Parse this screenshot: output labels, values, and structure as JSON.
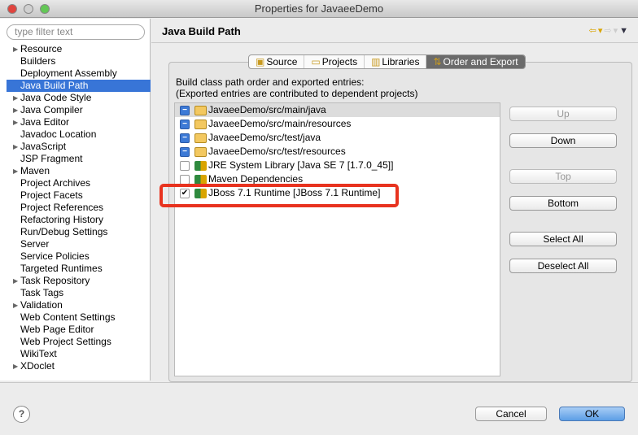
{
  "window": {
    "title": "Properties for JavaeeDemo"
  },
  "sidebar": {
    "filter_placeholder": "type filter text",
    "items": [
      {
        "label": "Resource",
        "expandable": true
      },
      {
        "label": "Builders"
      },
      {
        "label": "Deployment Assembly"
      },
      {
        "label": "Java Build Path",
        "selected": true
      },
      {
        "label": "Java Code Style",
        "expandable": true
      },
      {
        "label": "Java Compiler",
        "expandable": true
      },
      {
        "label": "Java Editor",
        "expandable": true
      },
      {
        "label": "Javadoc Location"
      },
      {
        "label": "JavaScript",
        "expandable": true
      },
      {
        "label": "JSP Fragment"
      },
      {
        "label": "Maven",
        "expandable": true
      },
      {
        "label": "Project Archives"
      },
      {
        "label": "Project Facets"
      },
      {
        "label": "Project References"
      },
      {
        "label": "Refactoring History"
      },
      {
        "label": "Run/Debug Settings"
      },
      {
        "label": "Server"
      },
      {
        "label": "Service Policies"
      },
      {
        "label": "Targeted Runtimes"
      },
      {
        "label": "Task Repository",
        "expandable": true
      },
      {
        "label": "Task Tags"
      },
      {
        "label": "Validation",
        "expandable": true
      },
      {
        "label": "Web Content Settings"
      },
      {
        "label": "Web Page Editor"
      },
      {
        "label": "Web Project Settings"
      },
      {
        "label": "WikiText"
      },
      {
        "label": "XDoclet",
        "expandable": true
      }
    ]
  },
  "header": {
    "title": "Java Build Path"
  },
  "tabs": [
    {
      "label": "Source"
    },
    {
      "label": "Projects"
    },
    {
      "label": "Libraries"
    },
    {
      "label": "Order and Export",
      "active": true
    }
  ],
  "description": {
    "line1": "Build class path order and exported entries:",
    "line2": "(Exported entries are contributed to dependent projects)"
  },
  "entries": [
    {
      "label": "JavaeeDemo/src/main/java",
      "state": "mixed",
      "icon": "folder"
    },
    {
      "label": "JavaeeDemo/src/main/resources",
      "state": "mixed",
      "icon": "folder"
    },
    {
      "label": "JavaeeDemo/src/test/java",
      "state": "mixed",
      "icon": "folder"
    },
    {
      "label": "JavaeeDemo/src/test/resources",
      "state": "mixed",
      "icon": "folder"
    },
    {
      "label": "JRE System Library [Java SE 7 [1.7.0_45]]",
      "state": "unchecked",
      "icon": "library"
    },
    {
      "label": "Maven Dependencies",
      "state": "unchecked",
      "icon": "library"
    },
    {
      "label": "JBoss 7.1 Runtime [JBoss 7.1 Runtime]",
      "state": "checked",
      "icon": "library"
    }
  ],
  "buttons": {
    "up": "Up",
    "down": "Down",
    "top": "Top",
    "bottom": "Bottom",
    "select_all": "Select All",
    "deselect_all": "Deselect All"
  },
  "footer": {
    "help": "?",
    "cancel": "Cancel",
    "ok": "OK"
  },
  "colors": {
    "highlight": "#e8331f",
    "selection": "#3875d7"
  }
}
